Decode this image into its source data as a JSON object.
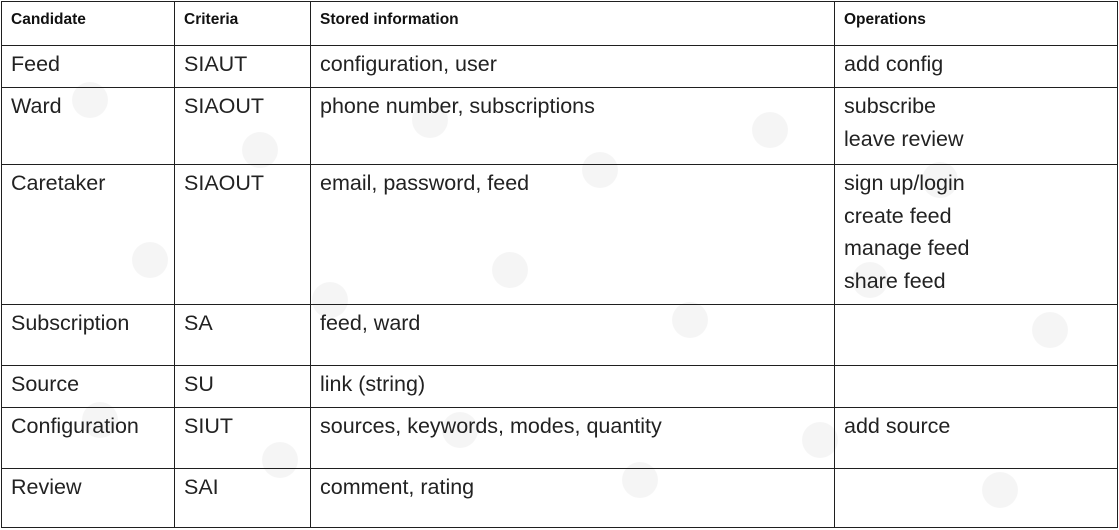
{
  "table": {
    "headers": [
      "Candidate",
      "Criteria",
      "Stored information",
      "Operations"
    ],
    "rows": [
      {
        "candidate": "Feed",
        "criteria": "SIAUT",
        "stored": "configuration, user",
        "operations": [
          "add config"
        ]
      },
      {
        "candidate": "Ward",
        "criteria": "SIAOUT",
        "stored": "phone number, subscriptions",
        "operations": [
          "subscribe",
          "leave review"
        ]
      },
      {
        "candidate": "Caretaker",
        "criteria": "SIAOUT",
        "stored": "email, password, feed",
        "operations": [
          "sign up/login",
          "create feed",
          "manage feed",
          "share feed"
        ]
      },
      {
        "candidate": "Subscription",
        "criteria": "SA",
        "stored": "feed, ward",
        "operations": []
      },
      {
        "candidate": "Source",
        "criteria": "SU",
        "stored": "link (string)",
        "operations": []
      },
      {
        "candidate": "Configuration",
        "criteria": "SIUT",
        "stored": "sources, keywords, modes, quantity",
        "operations": [
          "add source"
        ]
      },
      {
        "candidate": "Review",
        "criteria": "SAI",
        "stored": "comment, rating",
        "operations": []
      }
    ]
  }
}
